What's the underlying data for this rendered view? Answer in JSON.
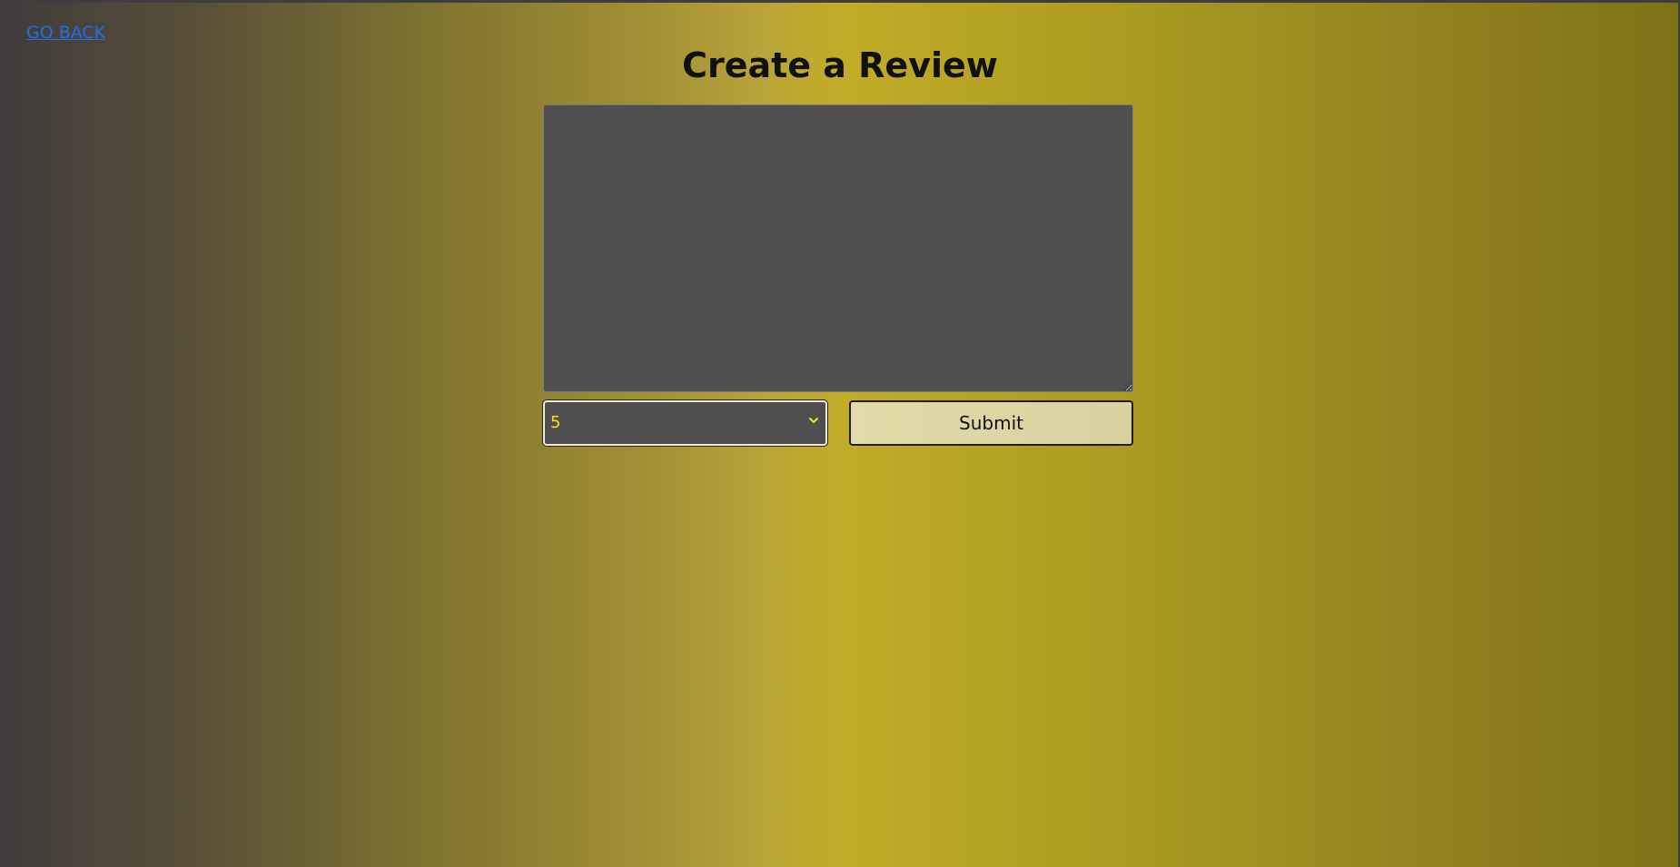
{
  "nav": {
    "go_back_label": "GO BACK"
  },
  "page": {
    "title": "Create a Review"
  },
  "form": {
    "review_text": "",
    "rating": {
      "selected": "5"
    },
    "submit_label": "Submit"
  },
  "colors": {
    "link": "#1f6fe6",
    "field_bg": "#4f4f4f",
    "rating_text": "#f3e21b",
    "submit_bg": "#e3dba6",
    "gradient_left": "#403b3c",
    "gradient_mid": "#c3ac27",
    "gradient_right": "#7e7217"
  },
  "icons": {
    "select_arrow": "chevron-down-icon"
  }
}
